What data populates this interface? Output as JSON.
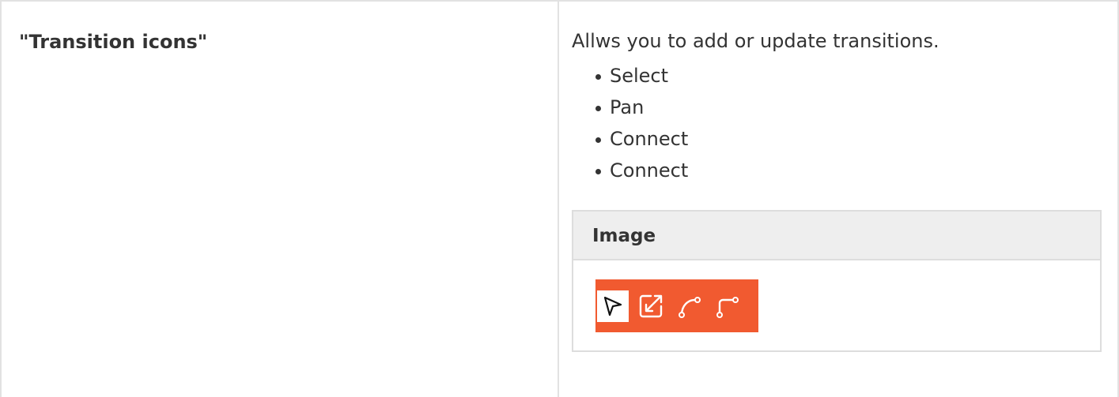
{
  "row": {
    "term": "\"Transition icons\"",
    "description": "Allws you to add or update transitions.",
    "options": [
      "Select",
      "Pan",
      "Connect",
      "Connect"
    ]
  },
  "image_panel": {
    "title": "Image",
    "toolbar": {
      "background_color": "#f15a30",
      "icons": [
        "select-arrow-icon",
        "pan-icon",
        "connect-curve-icon",
        "connect-elbow-icon"
      ],
      "selected_index": 0
    }
  }
}
